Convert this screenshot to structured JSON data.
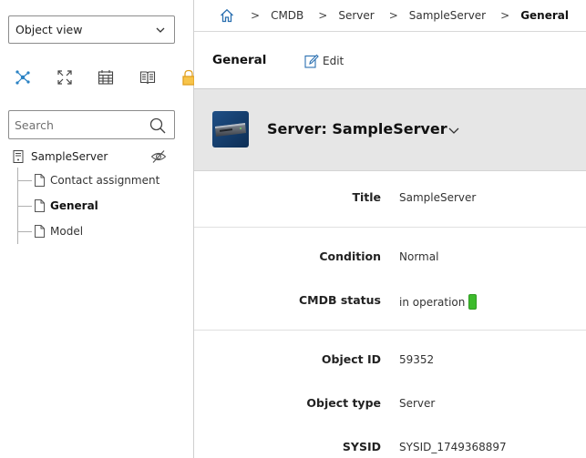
{
  "sidebar": {
    "view_select": {
      "value": "Object view"
    },
    "toolbar": {
      "icons": [
        "relations-icon",
        "fullscreen-icon",
        "calendar-icon",
        "book-icon",
        "lock-icon"
      ]
    },
    "search": {
      "placeholder": "Search",
      "value": ""
    },
    "tree": {
      "root": {
        "label": "SampleServer"
      },
      "items": [
        {
          "label": "Contact assignment",
          "active": false
        },
        {
          "label": "General",
          "active": true
        },
        {
          "label": "Model",
          "active": false
        }
      ]
    }
  },
  "breadcrumb": {
    "items": [
      "CMDB",
      "Server",
      "SampleServer",
      "General"
    ]
  },
  "header": {
    "section_title": "General",
    "edit_label": "Edit"
  },
  "object": {
    "title": "Server: SampleServer"
  },
  "attributes": {
    "title": {
      "label": "Title",
      "value": "SampleServer"
    },
    "condition": {
      "label": "Condition",
      "value": "Normal"
    },
    "cmdb_status": {
      "label": "CMDB status",
      "value": "in operation",
      "color": "#3dbb2c"
    },
    "object_id": {
      "label": "Object ID",
      "value": "59352"
    },
    "object_type": {
      "label": "Object type",
      "value": "Server"
    },
    "sysid": {
      "label": "SYSID",
      "value": "SYSID_1749368897"
    }
  },
  "colors": {
    "accent": "#2a82c4",
    "banner_bg": "#e6e6e6",
    "status_green": "#3dbb2c"
  }
}
